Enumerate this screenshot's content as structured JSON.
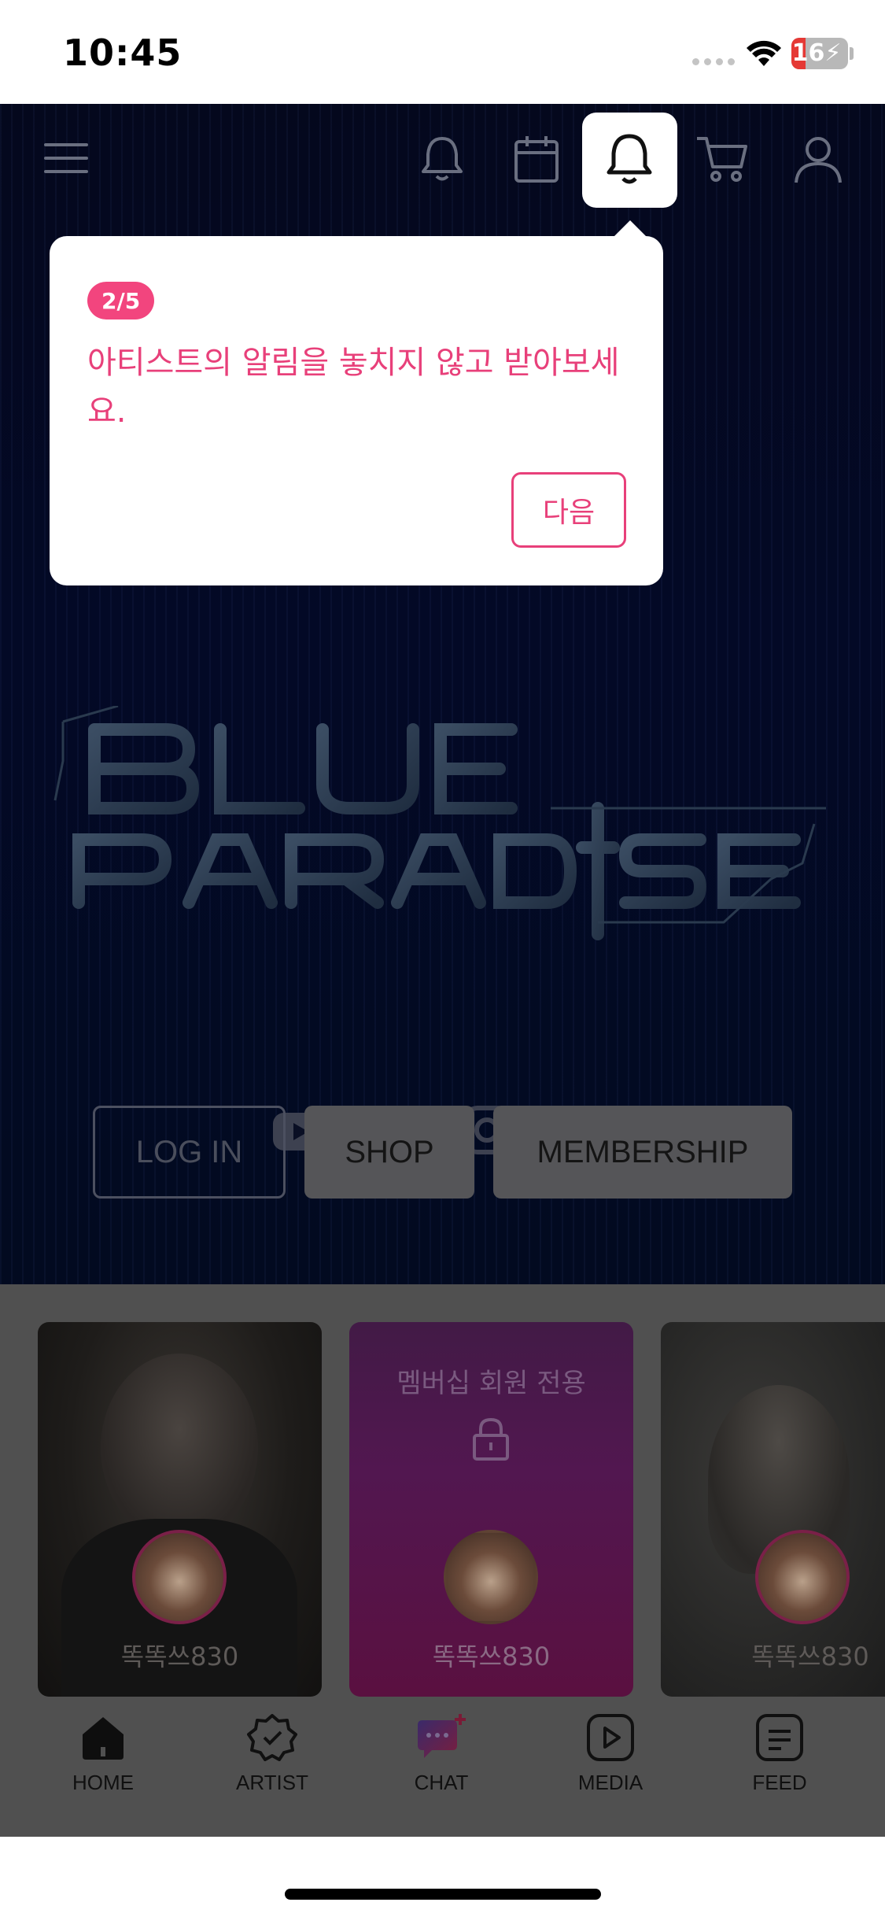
{
  "status_bar": {
    "time": "10:45",
    "battery_level": "16",
    "battery_fraction": 0.16,
    "charging": true
  },
  "header": {
    "icons": [
      "menu-icon",
      "bell-icon",
      "calendar-icon",
      "bell-icon-highlighted",
      "cart-icon",
      "profile-icon"
    ]
  },
  "tooltip": {
    "step": "2/5",
    "message": "아티스트의 알림을 놓치지 않고 받아보세요.",
    "next_label": "다음"
  },
  "hero": {
    "logo_text": "BLUE PARADISE",
    "social_icons": [
      "youtube-icon",
      "x-icon",
      "instagram-icon",
      "tiktok-icon"
    ],
    "buttons": {
      "login": "LOG IN",
      "shop": "SHOP",
      "membership": "MEMBERSHIP"
    }
  },
  "cards": [
    {
      "username": "똑똑쓰830",
      "locked": false
    },
    {
      "username": "똑똑쓰830",
      "locked": true,
      "lock_text": "멤버십 회원 전용"
    },
    {
      "username": "똑똑쓰830",
      "locked": false
    }
  ],
  "tabbar": {
    "tabs": [
      {
        "label": "HOME",
        "icon": "home-icon",
        "active": true
      },
      {
        "label": "ARTIST",
        "icon": "artist-badge-icon",
        "active": false
      },
      {
        "label": "CHAT",
        "icon": "chat-icon",
        "active": false
      },
      {
        "label": "MEDIA",
        "icon": "play-icon",
        "active": false
      },
      {
        "label": "FEED",
        "icon": "feed-icon",
        "active": false
      }
    ]
  },
  "colors": {
    "accent": "#e8407a",
    "badge": "#f2457e",
    "hero_bg": "#030926",
    "overlay_gray": "#505050"
  }
}
